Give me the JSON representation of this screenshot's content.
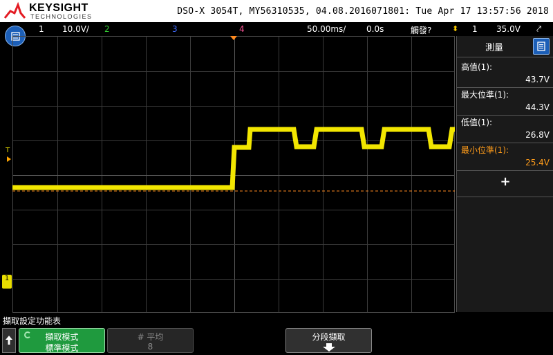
{
  "header": {
    "brand": "KEYSIGHT",
    "brand_sub": "TECHNOLOGIES",
    "scope_id": "DSO-X 3054T, MY56310535, 04.08.2016071801: Tue Apr 17 13:57:56 2018"
  },
  "status": {
    "ch1_num": "1",
    "ch1_scale": "10.0V/",
    "ch2_num": "2",
    "ch3_num": "3",
    "ch4_num": "4",
    "timebase": "50.00ms/",
    "delay": "0.0s",
    "trigger_state": "觸發?",
    "trig_source": "1",
    "trig_level": "35.0V"
  },
  "markers": {
    "trigger_level_label": "T",
    "ground_label": "1"
  },
  "panel": {
    "title": "測量",
    "measurements": [
      {
        "label": "高值(1):",
        "value": "43.7V"
      },
      {
        "label": "最大位準(1):",
        "value": "44.3V"
      },
      {
        "label": "低值(1):",
        "value": "26.8V"
      },
      {
        "label": "最小位準(1):",
        "value": "25.4V"
      }
    ],
    "add_label": "+"
  },
  "softkeys": {
    "menu_title": "擷取設定功能表",
    "acq_mode_title": "擷取模式",
    "acq_mode_value": "標準模式",
    "avg_title": "# 平均",
    "avg_value": "8",
    "segmented_title": "分段擷取"
  },
  "colors": {
    "ch1": "#f2e600",
    "ch2": "#33cc33",
    "ch3": "#3f6cff",
    "ch4": "#ff5599",
    "accent": "#1c5fb8",
    "highlight": "#ff9c1a"
  }
}
